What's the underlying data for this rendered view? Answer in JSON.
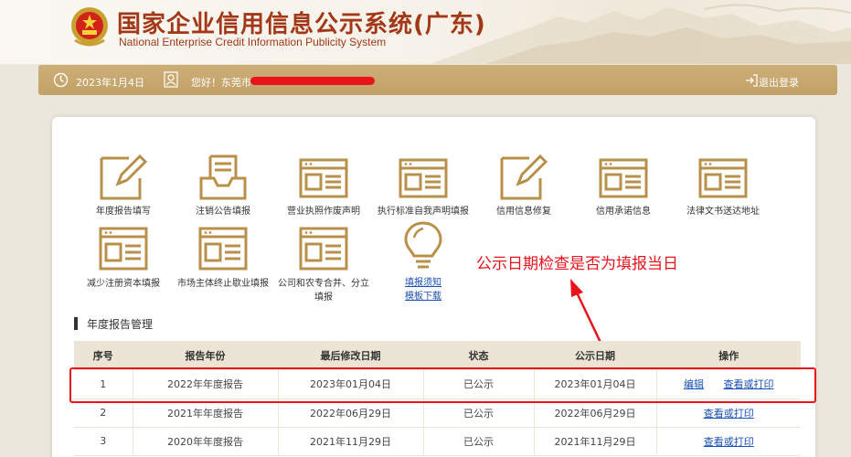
{
  "header": {
    "title": "国家企业信用信息公示系统(广东)",
    "subtitle": "National Enterprise Credit Information Publicity System"
  },
  "topbar": {
    "date": "2023年1月4日",
    "greeting": "您好！东莞市",
    "logout": "退出登录"
  },
  "tiles": [
    {
      "label": "年度报告填写",
      "icon": "edit-form-icon"
    },
    {
      "label": "注销公告填报",
      "icon": "inbox-tray-icon"
    },
    {
      "label": "营业执照作废声明",
      "icon": "document-card-icon"
    },
    {
      "label": "执行标准自我声明填报",
      "icon": "document-card-icon"
    },
    {
      "label": "信用信息修复",
      "icon": "edit-form-icon"
    },
    {
      "label": "信用承诺信息",
      "icon": "document-card-icon"
    },
    {
      "label": "法律文书送达地址",
      "icon": "document-card-icon"
    },
    {
      "label": "减少注册资本填报",
      "icon": "document-card-icon"
    },
    {
      "label": "市场主体终止歇业填报",
      "icon": "document-card-icon"
    },
    {
      "label_line1": "公司和农专合并、分立",
      "label_line2": "填报",
      "icon": "document-card-icon"
    },
    {
      "label_line1": "填报须知",
      "label_line2": "模板下载",
      "icon": "lightbulb-icon"
    }
  ],
  "annotation": "公示日期检查是否为填报当日",
  "section_title": "年度报告管理",
  "table": {
    "headers": [
      "序号",
      "报告年份",
      "最后修改日期",
      "状态",
      "公示日期",
      "操作"
    ],
    "rows": [
      {
        "no": "1",
        "year": "2022年年度报告",
        "modified": "2023年01月04日",
        "status": "已公示",
        "published": "2023年01月04日",
        "edit": "编辑",
        "view": "查看或打印"
      },
      {
        "no": "2",
        "year": "2021年年度报告",
        "modified": "2022年06月29日",
        "status": "已公示",
        "published": "2022年06月29日",
        "view": "查看或打印"
      },
      {
        "no": "3",
        "year": "2020年年度报告",
        "modified": "2021年11月29日",
        "status": "已公示",
        "published": "2021年11月29日",
        "view": "查看或打印"
      }
    ]
  },
  "colors": {
    "brand": "#a33818",
    "gold": "#c3a166",
    "annotation_red": "#e8141c",
    "link": "#1a4fb5"
  }
}
